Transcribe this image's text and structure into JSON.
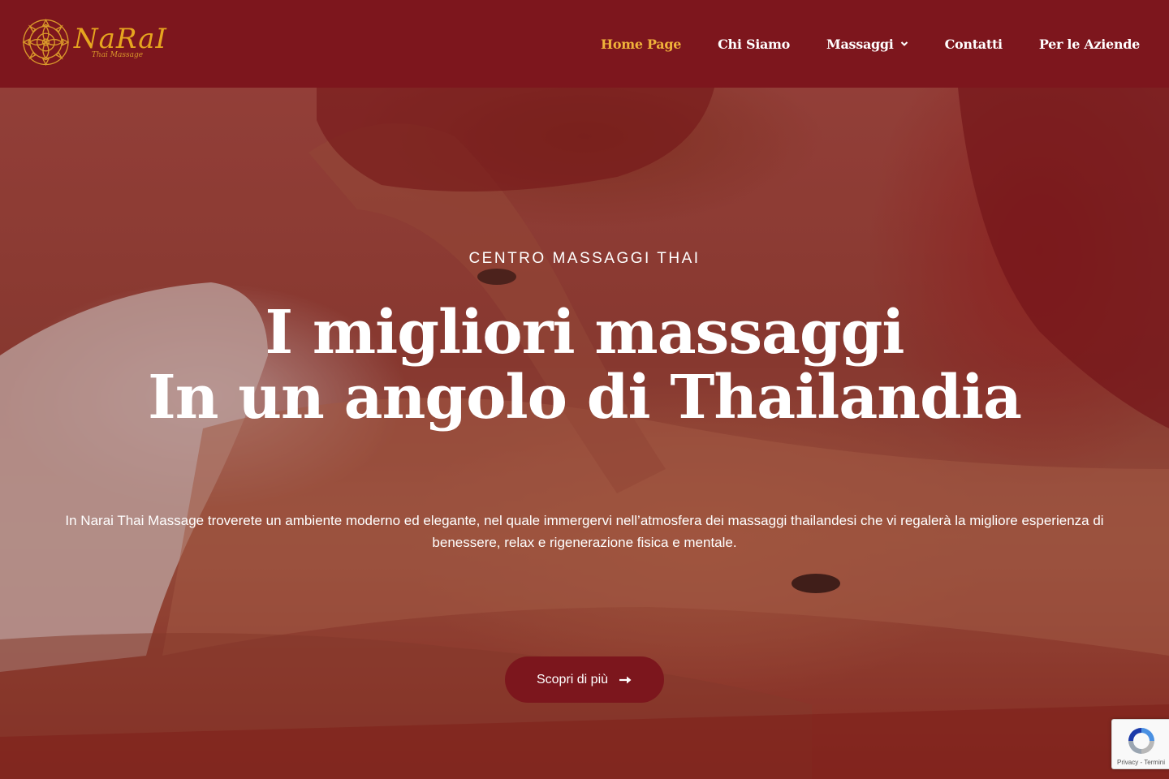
{
  "header": {
    "brand": {
      "name": "NaRaI",
      "tagline": "Thai Massage"
    },
    "nav": [
      {
        "label": "Home Page",
        "active": true
      },
      {
        "label": "Chi Siamo"
      },
      {
        "label": "Massaggi",
        "has_dropdown": true
      },
      {
        "label": "Contatti"
      },
      {
        "label": "Per le Aziende"
      }
    ]
  },
  "hero": {
    "eyebrow": "CENTRO MASSAGGI THAI",
    "headline_line1": "I migliori massaggi",
    "headline_line2": "In un angolo di Thailandia",
    "intro_line1": "In Narai Thai Massage troverete un ambiente moderno ed elegante, nel quale immergervi nell’atmosfera dei massaggi thailandesi che vi regalerà la migliore esperienza di",
    "intro_line2": "benessere, relax e rigenerazione fisica e mentale.",
    "cta_label": "Scopri di più",
    "cta_icon": "arrow-right-icon"
  },
  "recaptcha": {
    "links": "Privacy - Termini"
  },
  "colors": {
    "brand_red": "#7d161d",
    "nav_active": "#f0b33a",
    "logo_gold": "#e6a51f",
    "text": "#ffffff"
  }
}
